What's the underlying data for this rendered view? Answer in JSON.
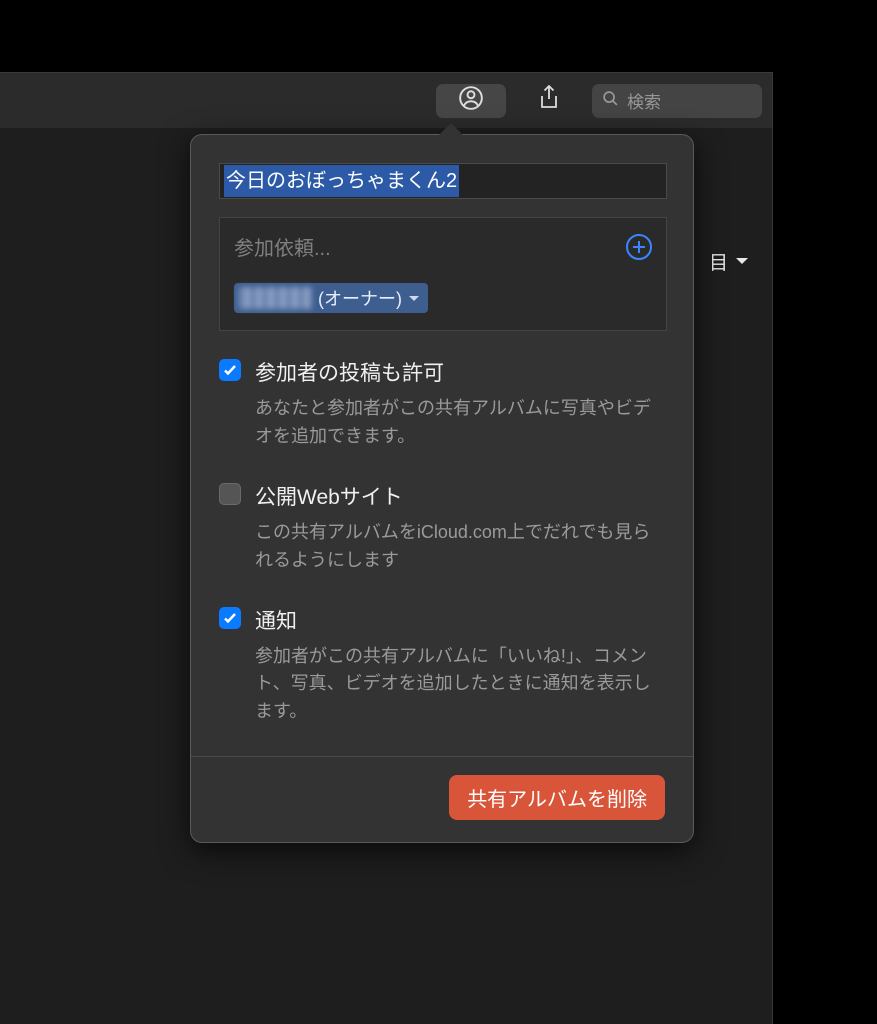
{
  "toolbar": {
    "people_icon": "people",
    "share_icon": "share",
    "search_placeholder": "検索"
  },
  "content": {
    "row_suffix": "目",
    "chevron": "▾"
  },
  "popover": {
    "album_title": "今日のおぼっちゃまくん2",
    "invite_placeholder": "参加依頼...",
    "owner_role": "(オーナー)",
    "options": {
      "allow_posts": {
        "checked": true,
        "label": "参加者の投稿も許可",
        "desc": "あなたと参加者がこの共有アルバムに写真やビデオを追加できます。"
      },
      "public_site": {
        "checked": false,
        "label": "公開Webサイト",
        "desc": "この共有アルバムをiCloud.com上でだれでも見られるようにします"
      },
      "notifications": {
        "checked": true,
        "label": "通知",
        "desc": "参加者がこの共有アルバムに「いいね!」、コメント、写真、ビデオを追加したときに通知を表示します。"
      }
    },
    "delete_label": "共有アルバムを削除"
  }
}
